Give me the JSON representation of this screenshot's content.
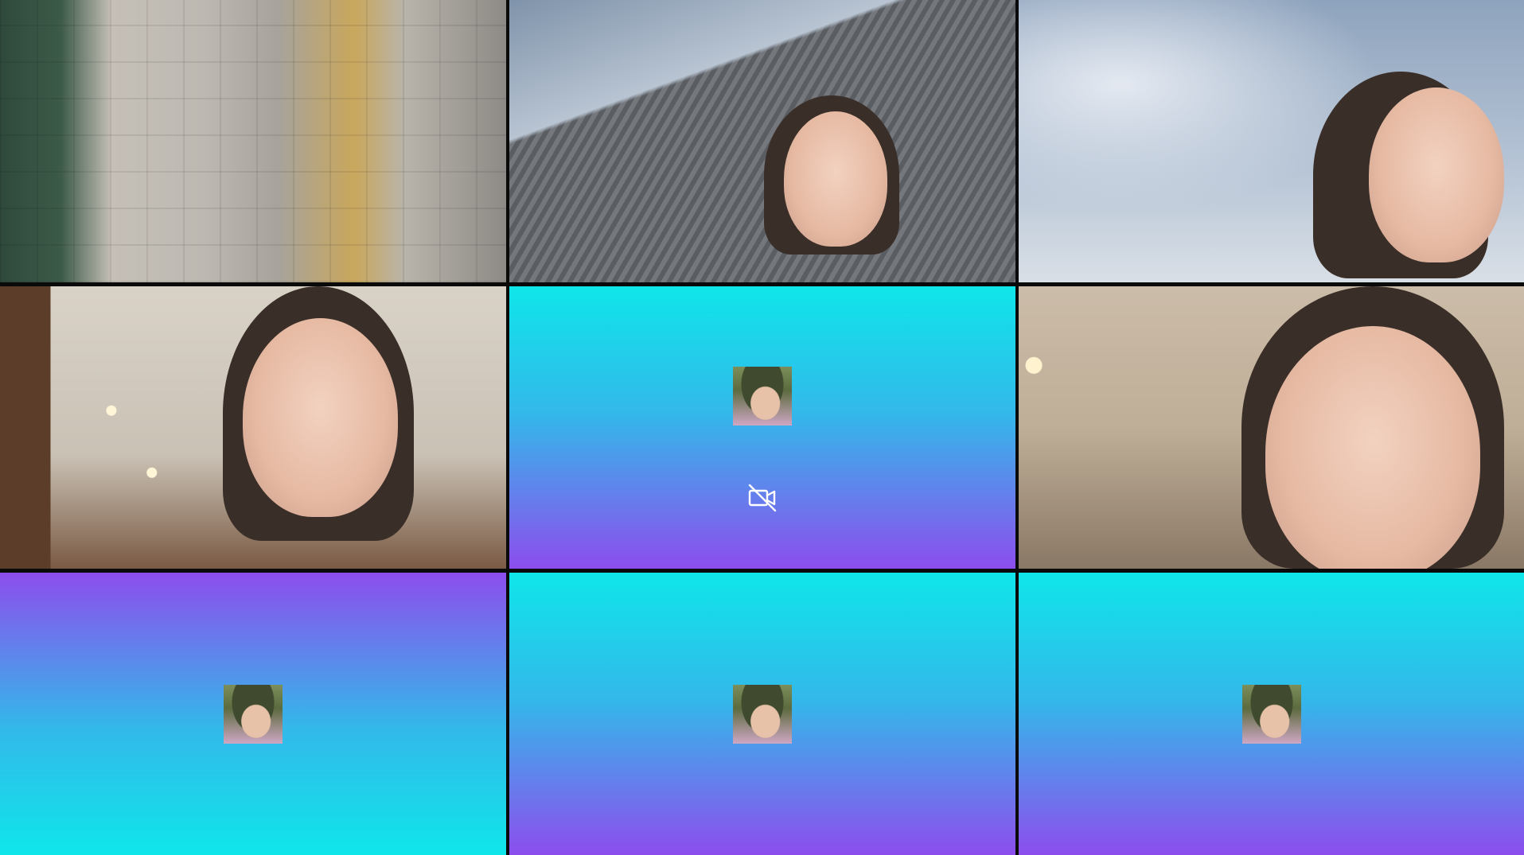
{
  "participants": [
    {
      "id": "tile-1",
      "video": "on",
      "scene": "sidewalk"
    },
    {
      "id": "tile-2",
      "video": "on",
      "scene": "building-sky"
    },
    {
      "id": "tile-3",
      "video": "on",
      "scene": "sky-city"
    },
    {
      "id": "tile-4",
      "video": "on",
      "scene": "indoor"
    },
    {
      "id": "tile-5",
      "video": "off",
      "avatar": "avatar-image",
      "indicator_icon": "camera-off-icon"
    },
    {
      "id": "tile-6",
      "video": "on",
      "scene": "indoor"
    },
    {
      "id": "tile-7",
      "video": "off",
      "avatar": "avatar-image"
    },
    {
      "id": "tile-8",
      "video": "off",
      "avatar": "avatar-image"
    },
    {
      "id": "tile-9",
      "video": "off",
      "avatar": "avatar-image"
    }
  ],
  "colors": {
    "gradient_cyan": "#0fe6ea",
    "gradient_purple": "#8c4ded",
    "separator": "#0a0a0a"
  }
}
